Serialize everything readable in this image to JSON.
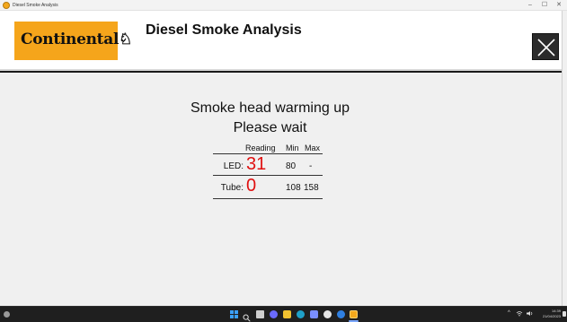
{
  "window": {
    "title": "Diesel Smoke Analysis",
    "minimize_glyph": "–",
    "maximize_glyph": "☐",
    "close_glyph": "✕"
  },
  "header": {
    "logo_text": "Continental",
    "logo_horse_glyph": "♘",
    "title": "Diesel Smoke Analysis",
    "close_icon": "close-icon",
    "logo_color": "#f5a51b"
  },
  "main": {
    "message_line1": "Smoke head warming up",
    "message_line2": "Please wait",
    "table": {
      "columns": [
        "Reading",
        "Min",
        "Max"
      ],
      "rows": [
        {
          "label": "LED:",
          "reading": "31",
          "min": "80",
          "max": "-"
        },
        {
          "label": "Tube:",
          "reading": "0",
          "min": "108",
          "max": "158"
        }
      ]
    },
    "reading_color": "#e01010"
  },
  "taskbar": {
    "icons": [
      "start-icon",
      "search-icon",
      "task-view-icon",
      "chat-icon",
      "file-explorer-icon",
      "edge-icon",
      "store-icon",
      "chrome-icon",
      "help-icon",
      "diesel-smoke-app-icon"
    ],
    "tray_chevron": "^",
    "time": "14:39",
    "date": "21/04/2023"
  }
}
